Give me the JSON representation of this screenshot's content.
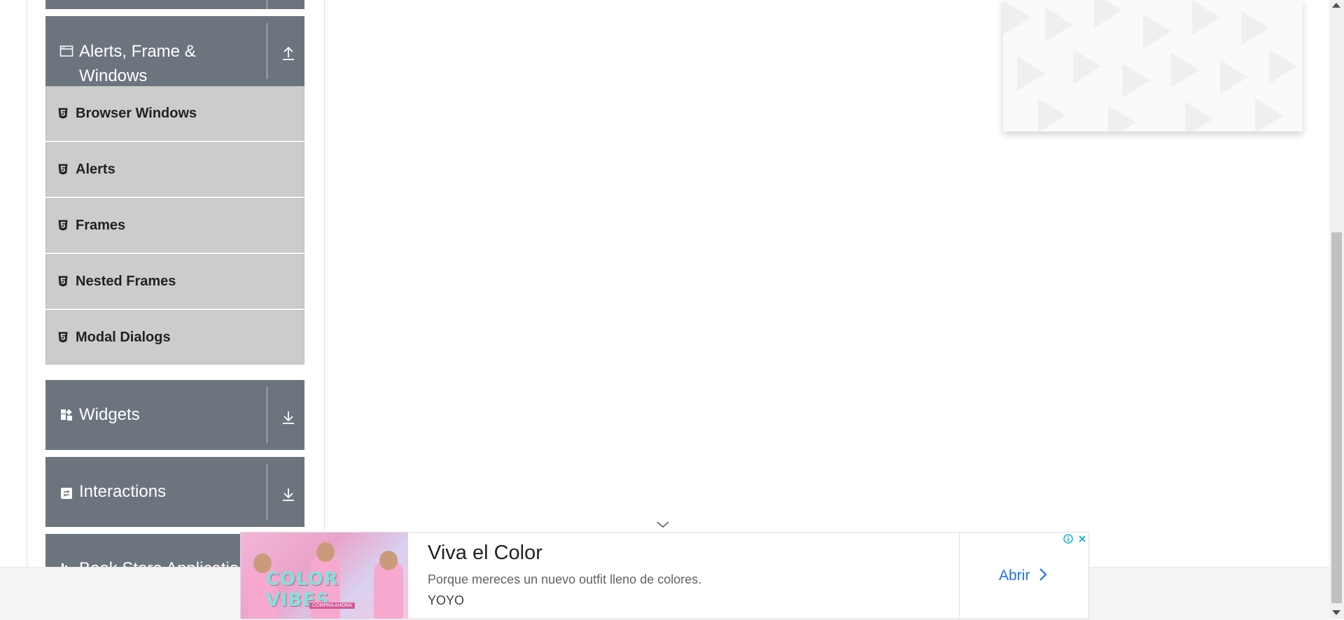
{
  "sidebar": {
    "groups": {
      "alerts": {
        "title_line1": "Alerts, Frame &",
        "title_line2": "Windows",
        "icon": "window-icon",
        "toggle": "collapse-up-icon"
      },
      "widgets": {
        "title": "Widgets",
        "icon": "widgets-icon",
        "toggle": "expand-down-icon"
      },
      "interactions": {
        "title": "Interactions",
        "icon": "interactions-icon",
        "toggle": "expand-down-icon"
      },
      "bookstore": {
        "title": "Book Store Applicatio",
        "icon": "book-icon"
      }
    },
    "items": [
      {
        "label": "Browser Windows",
        "icon": "html5-icon"
      },
      {
        "label": "Alerts",
        "icon": "html5-icon"
      },
      {
        "label": "Frames",
        "icon": "html5-icon"
      },
      {
        "label": "Nested Frames",
        "icon": "html5-icon"
      },
      {
        "label": "Modal Dialogs",
        "icon": "html5-icon"
      }
    ]
  },
  "ad": {
    "title": "Viva el Color",
    "description": "Porque mereces un nuevo outfit lleno de colores.",
    "advertiser": "YOYO",
    "cta": "Abrir",
    "image_text": "COLOR VIBES",
    "image_subtext": "COMPRA AHORA"
  },
  "colors": {
    "group_header": "#6c757d",
    "menu_item": "#cccccc",
    "cta": "#1a73e8"
  }
}
